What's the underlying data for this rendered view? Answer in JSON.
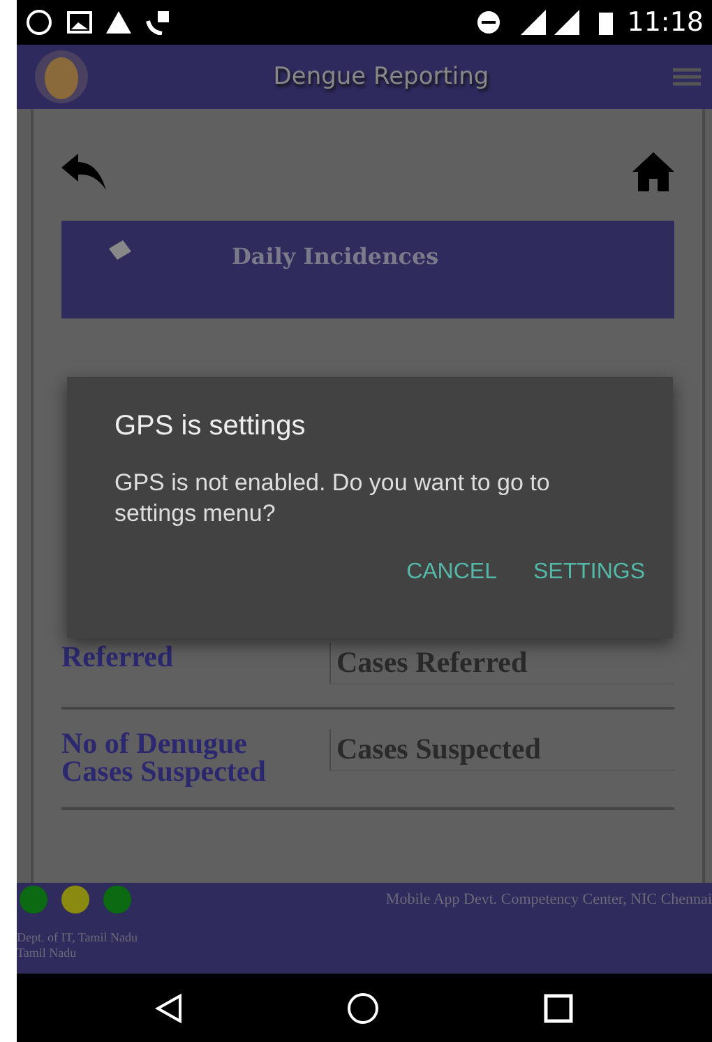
{
  "status_bar": {
    "time": "11:18"
  },
  "app_bar": {
    "title": "Dengue Reporting"
  },
  "banner": {
    "title": "Daily Incidences"
  },
  "form_rows": [
    {
      "label": "Referred",
      "value": "Cases Referred"
    },
    {
      "label": "No of Denugue Cases Suspected",
      "value": "Cases Suspected"
    }
  ],
  "dialog": {
    "title": "GPS is settings",
    "message": "GPS is not enabled. Do you want to go to settings menu?",
    "buttons": [
      "CANCEL",
      "SETTINGS"
    ]
  },
  "footer": {
    "dots": [
      {
        "color": "#0c6a12"
      },
      {
        "color": "#8a8a10"
      },
      {
        "color": "#0c6a12"
      }
    ],
    "credit": "Mobile App Devt. Competency Center, NIC Chennai",
    "lines": [
      "Dept. of IT, Tamil Nadu",
      "Tamil Nadu"
    ]
  }
}
